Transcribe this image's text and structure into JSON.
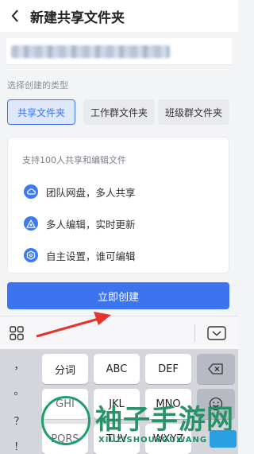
{
  "header": {
    "title": "新建共享文件夹",
    "back_icon": "chevron-left-icon"
  },
  "name_input": {
    "value_blurred": true
  },
  "type_section": {
    "label": "选择创建的类型",
    "types": [
      {
        "label": "共享文件夹",
        "selected": true
      },
      {
        "label": "工作群文件夹",
        "selected": false
      },
      {
        "label": "班级群文件夹",
        "selected": false
      }
    ]
  },
  "card": {
    "description": "支持100人共享和编辑文件",
    "features": [
      {
        "icon": "cloud-icon",
        "text": "团队网盘，多人共享"
      },
      {
        "icon": "edit-triangle-icon",
        "text": "多人编辑，实时更新"
      },
      {
        "icon": "settings-hex-icon",
        "text": "自主设置，谁可编辑"
      }
    ]
  },
  "create_button": {
    "label": "立即创建"
  },
  "keyboard": {
    "punctuation": [
      "，",
      "。",
      "？",
      "！"
    ],
    "row1": [
      "分词",
      "ABC",
      "DEF"
    ],
    "row2": [
      "GHI",
      "JKL",
      "MNO"
    ],
    "row3": [
      "PQRS",
      "TUV",
      "WXYZ"
    ]
  },
  "watermark": {
    "title": "袖子手游网",
    "subtitle": "XIUZISHOUYOUWANG"
  },
  "colors": {
    "accent": "#3c73ee",
    "annotation_arrow": "#e8332a",
    "watermark": "#1f8e62"
  }
}
